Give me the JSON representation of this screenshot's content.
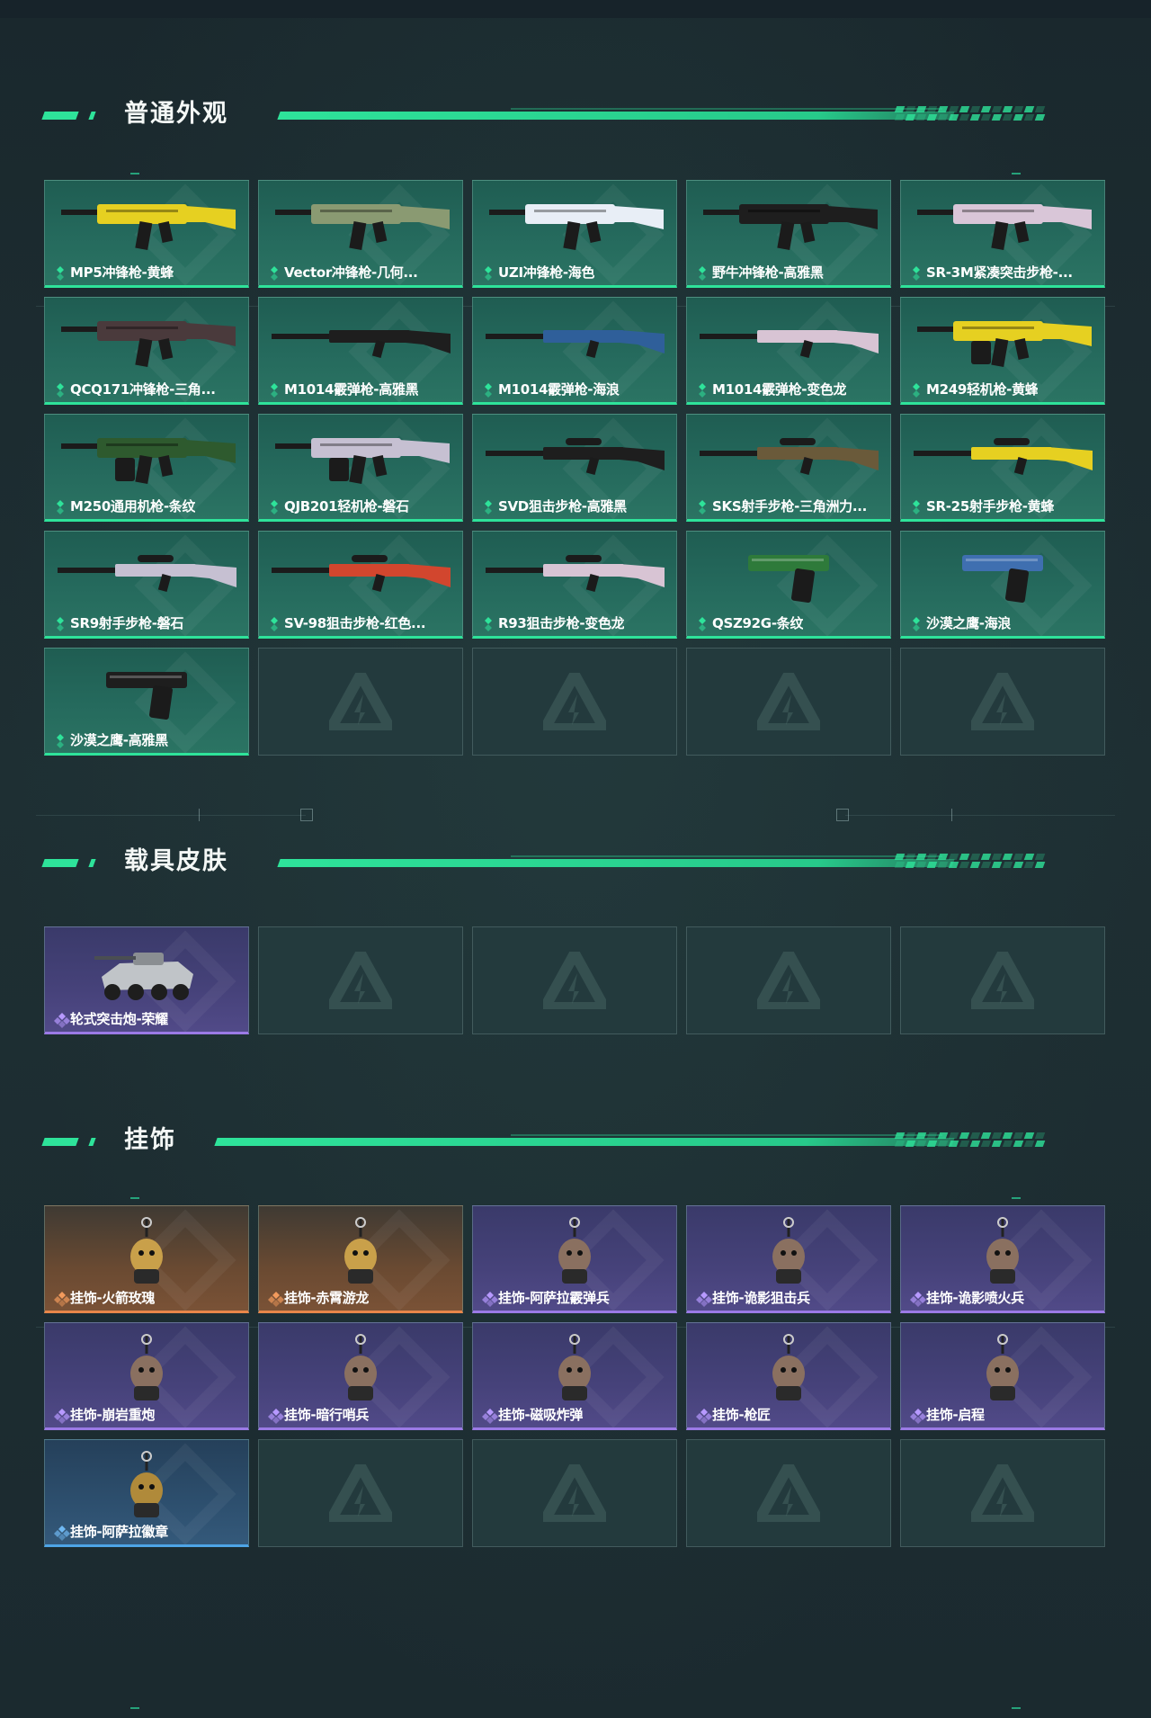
{
  "sections": {
    "weapons": {
      "title": "普通外观",
      "items": [
        {
          "label": "MP5冲锋枪-黄蜂",
          "icon": "smg-icon",
          "color": "#e6d021"
        },
        {
          "label": "Vector冲锋枪-几何...",
          "icon": "smg-icon",
          "color": "#8a9a72"
        },
        {
          "label": "UZI冲锋枪-海色",
          "icon": "smg-icon",
          "color": "#e8eef6"
        },
        {
          "label": "野牛冲锋枪-高雅黑",
          "icon": "smg-icon",
          "color": "#1e1e1e"
        },
        {
          "label": "SR-3M紧凑突击步枪-...",
          "icon": "rifle-icon",
          "color": "#d9c6d8"
        },
        {
          "label": "QCQ171冲锋枪-三角...",
          "icon": "smg-icon",
          "color": "#4a3a3c"
        },
        {
          "label": "M1014霰弹枪-高雅黑",
          "icon": "shotgun-icon",
          "color": "#1e1e1e"
        },
        {
          "label": "M1014霰弹枪-海浪",
          "icon": "shotgun-icon",
          "color": "#2f5f9a"
        },
        {
          "label": "M1014霰弹枪-变色龙",
          "icon": "shotgun-icon",
          "color": "#d8c4d4"
        },
        {
          "label": "M249轻机枪-黄蜂",
          "icon": "lmg-icon",
          "color": "#e6d021"
        },
        {
          "label": "M250通用机枪-条纹",
          "icon": "lmg-icon",
          "color": "#2e5a2e"
        },
        {
          "label": "QJB201轻机枪-磐石",
          "icon": "lmg-icon",
          "color": "#c6c0d2"
        },
        {
          "label": "SVD狙击步枪-高雅黑",
          "icon": "sniper-icon",
          "color": "#1e1e1e"
        },
        {
          "label": "SKS射手步枪-三角洲力...",
          "icon": "sniper-icon",
          "color": "#6a5a3a"
        },
        {
          "label": "SR-25射手步枪-黄蜂",
          "icon": "sniper-icon",
          "color": "#e6d021"
        },
        {
          "label": "SR9射手步枪-磐石",
          "icon": "sniper-icon",
          "color": "#c6c0d2"
        },
        {
          "label": "SV-98狙击步枪-红色...",
          "icon": "sniper-icon",
          "color": "#d2462e"
        },
        {
          "label": "R93狙击步枪-变色龙",
          "icon": "sniper-icon",
          "color": "#d8c4d4"
        },
        {
          "label": "QSZ92G-条纹",
          "icon": "pistol-icon",
          "color": "#2e7a3a"
        },
        {
          "label": "沙漠之鹰-海浪",
          "icon": "pistol-icon",
          "color": "#3f6fb0"
        },
        {
          "label": "沙漠之鹰-高雅黑",
          "icon": "pistol-icon",
          "color": "#1e1e1e"
        }
      ],
      "empty_count": 4
    },
    "vehicles": {
      "title": "载具皮肤",
      "items": [
        {
          "label": "轮式突击炮-荣耀",
          "icon": "vehicle-icon",
          "color": "#c0c4c8"
        }
      ],
      "empty_count": 4
    },
    "charms": {
      "title": "挂饰",
      "items": [
        {
          "label": "挂饰-火箭玫瑰",
          "icon": "charm-icon",
          "rarity": "orange"
        },
        {
          "label": "挂饰-赤霄游龙",
          "icon": "charm-icon",
          "rarity": "orange"
        },
        {
          "label": "挂饰-阿萨拉霰弹兵",
          "icon": "charm-icon",
          "rarity": "purple"
        },
        {
          "label": "挂饰-诡影狙击兵",
          "icon": "charm-icon",
          "rarity": "purple"
        },
        {
          "label": "挂饰-诡影喷火兵",
          "icon": "charm-icon",
          "rarity": "purple"
        },
        {
          "label": "挂饰-崩岩重炮",
          "icon": "charm-icon",
          "rarity": "purple"
        },
        {
          "label": "挂饰-暗行哨兵",
          "icon": "charm-icon",
          "rarity": "purple"
        },
        {
          "label": "挂饰-磁吸炸弹",
          "icon": "charm-icon",
          "rarity": "purple"
        },
        {
          "label": "挂饰-枪匠",
          "icon": "charm-icon",
          "rarity": "purple"
        },
        {
          "label": "挂饰-启程",
          "icon": "charm-icon",
          "rarity": "purple"
        },
        {
          "label": "挂饰-阿萨拉徽章",
          "icon": "charm-icon",
          "rarity": "blue"
        }
      ],
      "empty_count": 4
    }
  },
  "colors": {
    "accent": "#2ee39a",
    "rarity_green": "#2ee39a",
    "rarity_purple": "#9b7ae6",
    "rarity_orange": "#e8864a",
    "rarity_blue": "#4ea4e6"
  }
}
